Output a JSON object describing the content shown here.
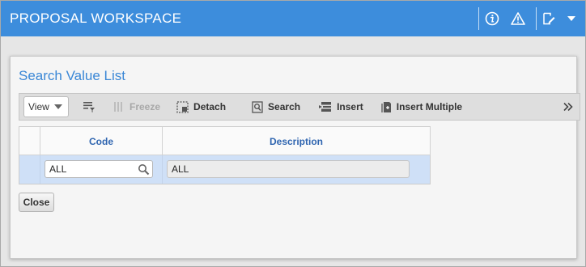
{
  "header": {
    "title": "PROPOSAL WORKSPACE",
    "icons": [
      "info-icon",
      "warning-icon",
      "edit-note-icon",
      "dropdown-caret-icon"
    ],
    "bg_color": "#3d8ddc"
  },
  "dialog": {
    "title": "Search Value List",
    "toolbar": {
      "view_label": "View",
      "freeze_label": "Freeze",
      "detach_label": "Detach",
      "search_label": "Search",
      "insert_label": "Insert",
      "insert_multiple_label": "Insert Multiple",
      "more_label": "»"
    },
    "grid": {
      "columns": [
        "Code",
        "Description"
      ],
      "rows": [
        {
          "code": "ALL",
          "description": "ALL"
        }
      ]
    },
    "close_label": "Close"
  }
}
